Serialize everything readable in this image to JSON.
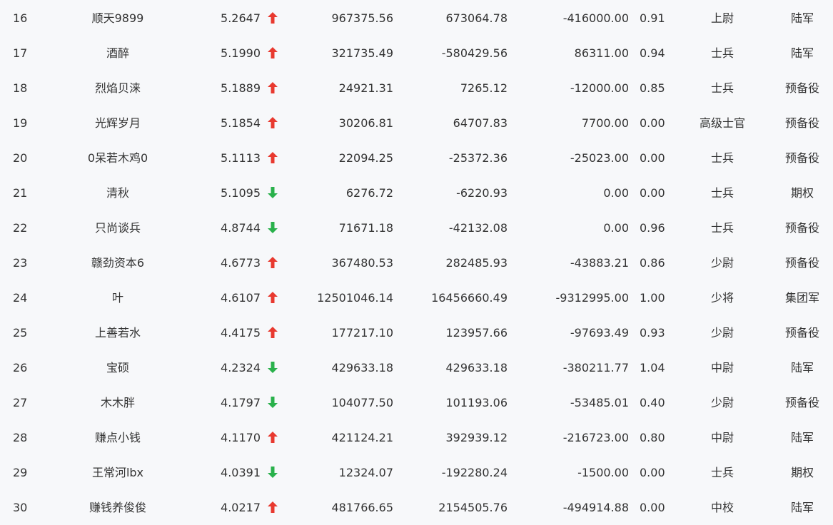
{
  "colors": {
    "up": "#e8392f",
    "down": "#29b14b",
    "text": "#333333",
    "background": "#f7f8fa"
  },
  "rows": [
    {
      "rank": "16",
      "name": "顺天9899",
      "score": "5.2647",
      "trend": "up",
      "v1": "967375.56",
      "v2": "673064.78",
      "v3": "-416000.00",
      "ratio": "0.91",
      "title": "上尉",
      "group": "陆军"
    },
    {
      "rank": "17",
      "name": "酒醉",
      "score": "5.1990",
      "trend": "up",
      "v1": "321735.49",
      "v2": "-580429.56",
      "v3": "86311.00",
      "ratio": "0.94",
      "title": "士兵",
      "group": "陆军"
    },
    {
      "rank": "18",
      "name": "烈焰贝涞",
      "score": "5.1889",
      "trend": "up",
      "v1": "24921.31",
      "v2": "7265.12",
      "v3": "-12000.00",
      "ratio": "0.85",
      "title": "士兵",
      "group": "预备役"
    },
    {
      "rank": "19",
      "name": "光辉岁月",
      "score": "5.1854",
      "trend": "up",
      "v1": "30206.81",
      "v2": "64707.83",
      "v3": "7700.00",
      "ratio": "0.00",
      "title": "高级士官",
      "group": "预备役"
    },
    {
      "rank": "20",
      "name": "0呆若木鸡0",
      "score": "5.1113",
      "trend": "up",
      "v1": "22094.25",
      "v2": "-25372.36",
      "v3": "-25023.00",
      "ratio": "0.00",
      "title": "士兵",
      "group": "预备役"
    },
    {
      "rank": "21",
      "name": "清秋",
      "score": "5.1095",
      "trend": "down",
      "v1": "6276.72",
      "v2": "-6220.93",
      "v3": "0.00",
      "ratio": "0.00",
      "title": "士兵",
      "group": "期权"
    },
    {
      "rank": "22",
      "name": "只尚谈兵",
      "score": "4.8744",
      "trend": "down",
      "v1": "71671.18",
      "v2": "-42132.08",
      "v3": "0.00",
      "ratio": "0.96",
      "title": "士兵",
      "group": "预备役"
    },
    {
      "rank": "23",
      "name": "赣劲资本6",
      "score": "4.6773",
      "trend": "up",
      "v1": "367480.53",
      "v2": "282485.93",
      "v3": "-43883.21",
      "ratio": "0.86",
      "title": "少尉",
      "group": "预备役"
    },
    {
      "rank": "24",
      "name": "叶",
      "score": "4.6107",
      "trend": "up",
      "v1": "12501046.14",
      "v2": "16456660.49",
      "v3": "-9312995.00",
      "ratio": "1.00",
      "title": "少将",
      "group": "集团军"
    },
    {
      "rank": "25",
      "name": "上善若水",
      "score": "4.4175",
      "trend": "up",
      "v1": "177217.10",
      "v2": "123957.66",
      "v3": "-97693.49",
      "ratio": "0.93",
      "title": "少尉",
      "group": "预备役"
    },
    {
      "rank": "26",
      "name": "宝硕",
      "score": "4.2324",
      "trend": "down",
      "v1": "429633.18",
      "v2": "429633.18",
      "v3": "-380211.77",
      "ratio": "1.04",
      "title": "中尉",
      "group": "陆军"
    },
    {
      "rank": "27",
      "name": "木木胖",
      "score": "4.1797",
      "trend": "down",
      "v1": "104077.50",
      "v2": "101193.06",
      "v3": "-53485.01",
      "ratio": "0.40",
      "title": "少尉",
      "group": "预备役"
    },
    {
      "rank": "28",
      "name": "赚点小钱",
      "score": "4.1170",
      "trend": "up",
      "v1": "421124.21",
      "v2": "392939.12",
      "v3": "-216723.00",
      "ratio": "0.80",
      "title": "中尉",
      "group": "陆军"
    },
    {
      "rank": "29",
      "name": "王常河lbx",
      "score": "4.0391",
      "trend": "down",
      "v1": "12324.07",
      "v2": "-192280.24",
      "v3": "-1500.00",
      "ratio": "0.00",
      "title": "士兵",
      "group": "期权"
    },
    {
      "rank": "30",
      "name": "赚钱养俊俊",
      "score": "4.0217",
      "trend": "up",
      "v1": "481766.65",
      "v2": "2154505.76",
      "v3": "-494914.88",
      "ratio": "0.00",
      "title": "中校",
      "group": "陆军"
    }
  ]
}
